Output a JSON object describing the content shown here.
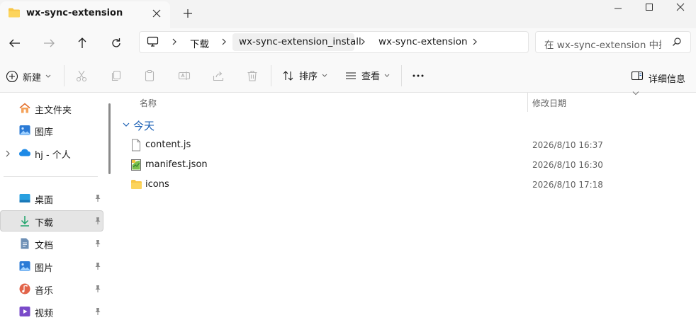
{
  "window": {
    "tab_title": "wx-sync-extension",
    "new_tab": "+"
  },
  "breadcrumb": [
    "下载",
    "wx-sync-extension_install",
    "wx-sync-extension"
  ],
  "search": {
    "placeholder": "在 wx-sync-extension 中搜"
  },
  "toolbar": {
    "new_label": "新建",
    "sort_label": "排序",
    "view_label": "查看",
    "more_label": "···",
    "details_label": "详细信息"
  },
  "sidebar": {
    "top_items": [
      {
        "label": "主文件夹",
        "icon": "home-icon"
      },
      {
        "label": "图库",
        "icon": "gallery-icon"
      },
      {
        "label": "hj - 个人",
        "icon": "cloud-icon"
      }
    ],
    "pinned_items": [
      {
        "label": "桌面",
        "icon": "desktop-icon"
      },
      {
        "label": "下载",
        "icon": "download-icon",
        "selected": true
      },
      {
        "label": "文档",
        "icon": "document-icon"
      },
      {
        "label": "图片",
        "icon": "pictures-icon"
      },
      {
        "label": "音乐",
        "icon": "music-icon"
      },
      {
        "label": "视频",
        "icon": "video-icon"
      }
    ]
  },
  "columns": {
    "name": "名称",
    "modified": "修改日期"
  },
  "group": {
    "label": "今天"
  },
  "files": [
    {
      "name": "content.js",
      "modified": "2026/8/10 16:37",
      "icon": "js-file-icon"
    },
    {
      "name": "manifest.json",
      "modified": "2026/8/10 16:30",
      "icon": "json-file-icon"
    },
    {
      "name": "icons",
      "modified": "2026/8/10 17:18",
      "icon": "folder-icon"
    }
  ],
  "colors": {
    "accent": "#1a5fb4",
    "folder": "#f8c646",
    "selected_bg": "#e5e5e5"
  }
}
